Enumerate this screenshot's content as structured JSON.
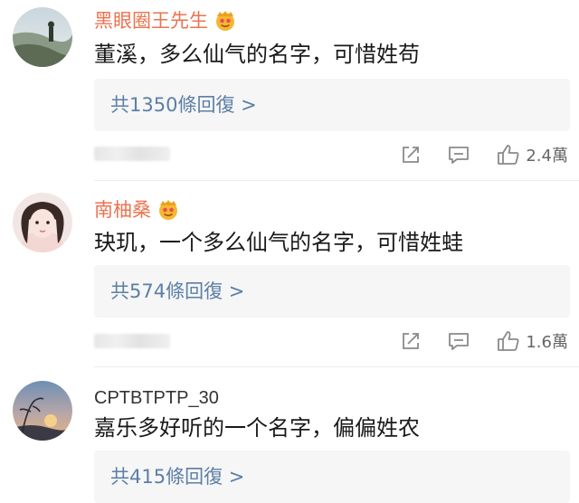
{
  "comments": [
    {
      "username": "黑眼圈王先生",
      "text": "董溪，多么仙气的名字，可惜姓苟",
      "reply_label": "共1350條回復 >",
      "like_count": "2.4萬",
      "name_color": "#eb7350",
      "has_badge": true
    },
    {
      "username": "南柚桑",
      "text": "玦玑，一个多么仙气的名字，可惜姓蛙",
      "reply_label": "共574條回復 >",
      "like_count": "1.6萬",
      "name_color": "#eb7350",
      "has_badge": true
    },
    {
      "username": "CPTBTPTP_30",
      "text": "嘉乐多好听的一个名字，偏偏姓农",
      "reply_label": "共415條回復 >",
      "name_color": "#333333",
      "has_badge": false
    }
  ],
  "icons": {
    "share": "share-icon",
    "comment": "comment-icon",
    "like": "thumbs-up-icon",
    "badge": "vip-emoji-badge-icon"
  },
  "colors": {
    "reply_link": "#5b7fa6",
    "reply_bg": "#f6f6f6",
    "icon_gray": "#8a8a8a"
  }
}
